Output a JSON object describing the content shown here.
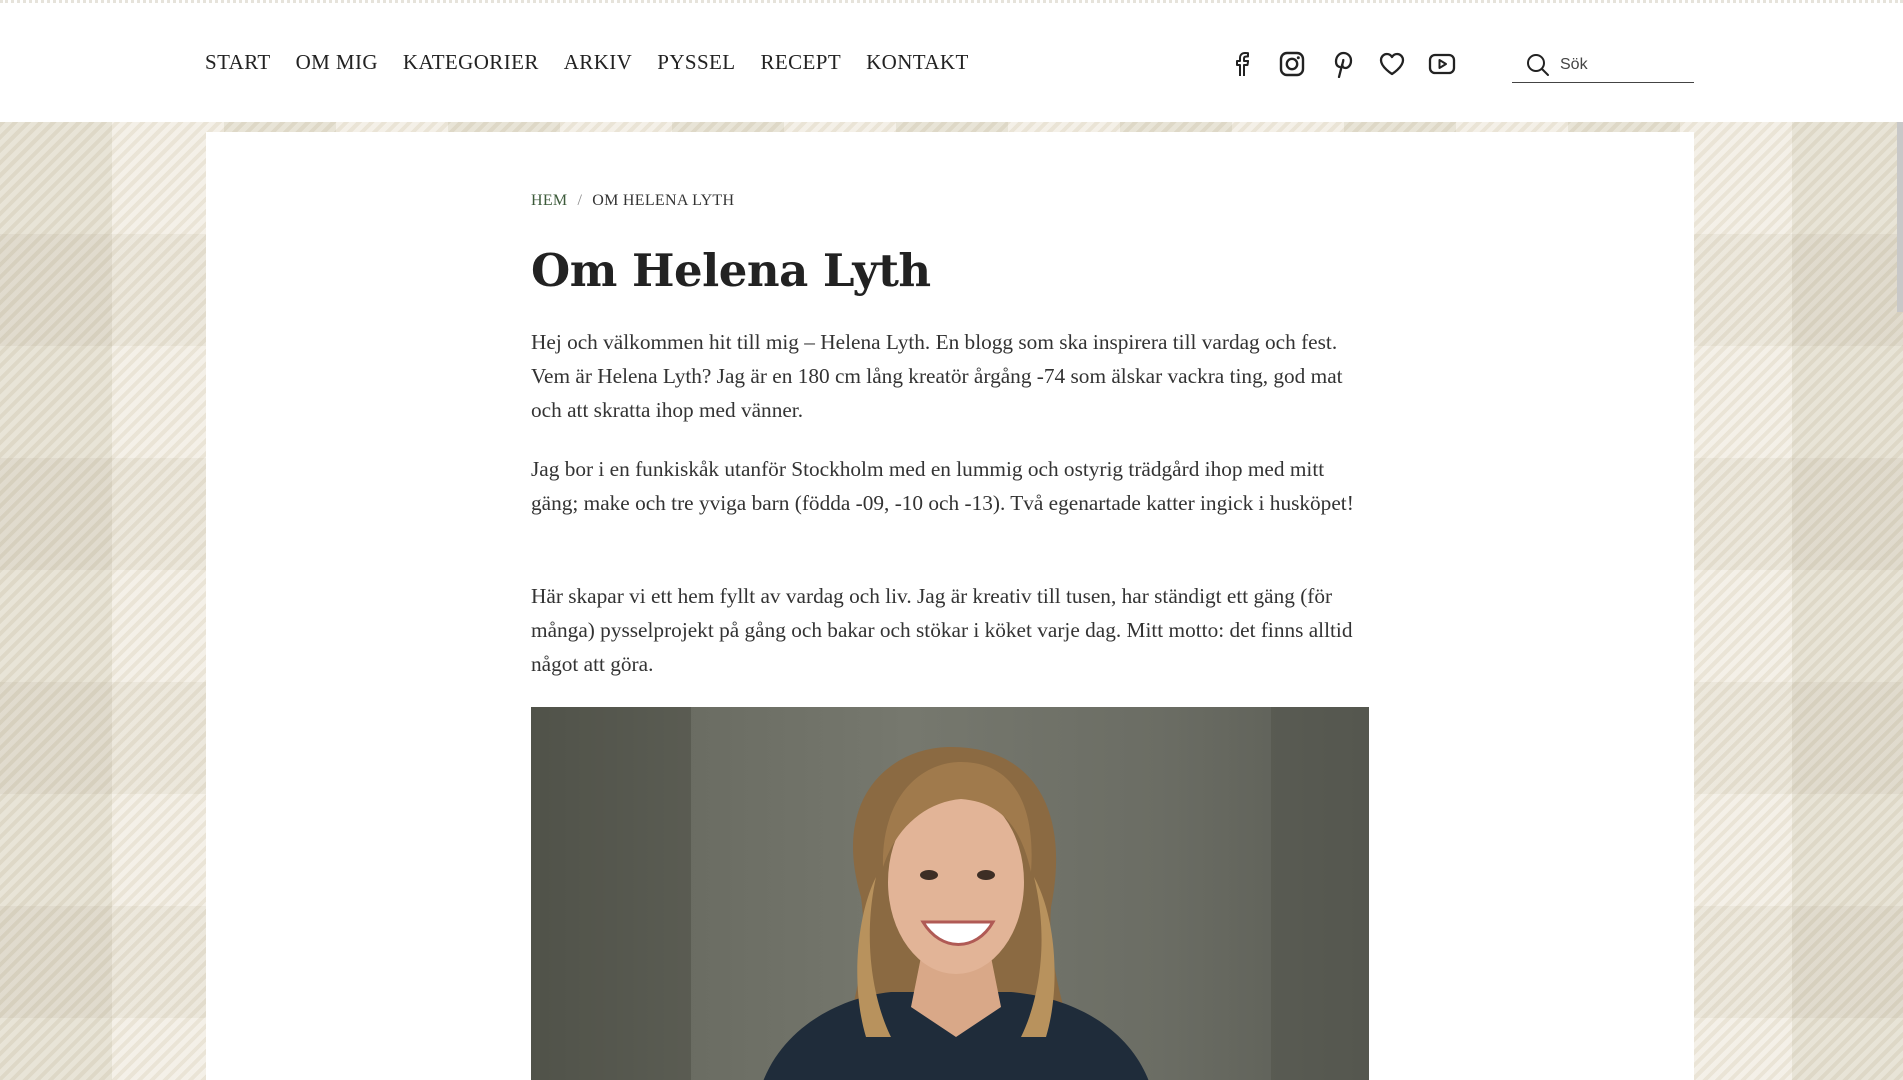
{
  "nav": {
    "items": [
      {
        "label": "START"
      },
      {
        "label": "OM MIG"
      },
      {
        "label": "KATEGORIER"
      },
      {
        "label": "ARKIV"
      },
      {
        "label": "PYSSEL"
      },
      {
        "label": "RECEPT"
      },
      {
        "label": "KONTAKT"
      }
    ]
  },
  "social": [
    {
      "icon": "facebook-icon"
    },
    {
      "icon": "instagram-icon"
    },
    {
      "icon": "pinterest-icon"
    },
    {
      "icon": "heart-icon"
    },
    {
      "icon": "youtube-icon"
    }
  ],
  "search": {
    "placeholder": "Sök"
  },
  "breadcrumb": {
    "home": "HEM",
    "separator": "/",
    "current": "OM HELENA LYTH"
  },
  "article": {
    "title": "Om Helena Lyth",
    "paragraphs": [
      "Hej och välkommen hit till mig – Helena Lyth. En blogg som ska inspirera till vardag och fest. Vem är Helena Lyth? Jag är en 180 cm lång kreatör årgång -74 som älskar vackra ting, god mat och att skratta ihop med vänner.",
      "Jag bor i en funkiskåk utanför Stockholm med en lummig och ostyrig trädgård ihop med mitt gäng; make och tre yviga barn (födda -09, -10 och -13). Två egenartade katter ingick i husköpet!",
      "Här skapar vi ett hem fyllt av vardag och liv. Jag är kreativ till tusen, har ständigt ett gäng (för många) pysselprojekt på gång och bakar och stökar i köket varje dag. Mitt motto: det finns alltid något att göra."
    ]
  },
  "colors": {
    "breadcrumb_link": "#3c5a3a",
    "background": "#f4f2ec",
    "text": "#333333"
  }
}
